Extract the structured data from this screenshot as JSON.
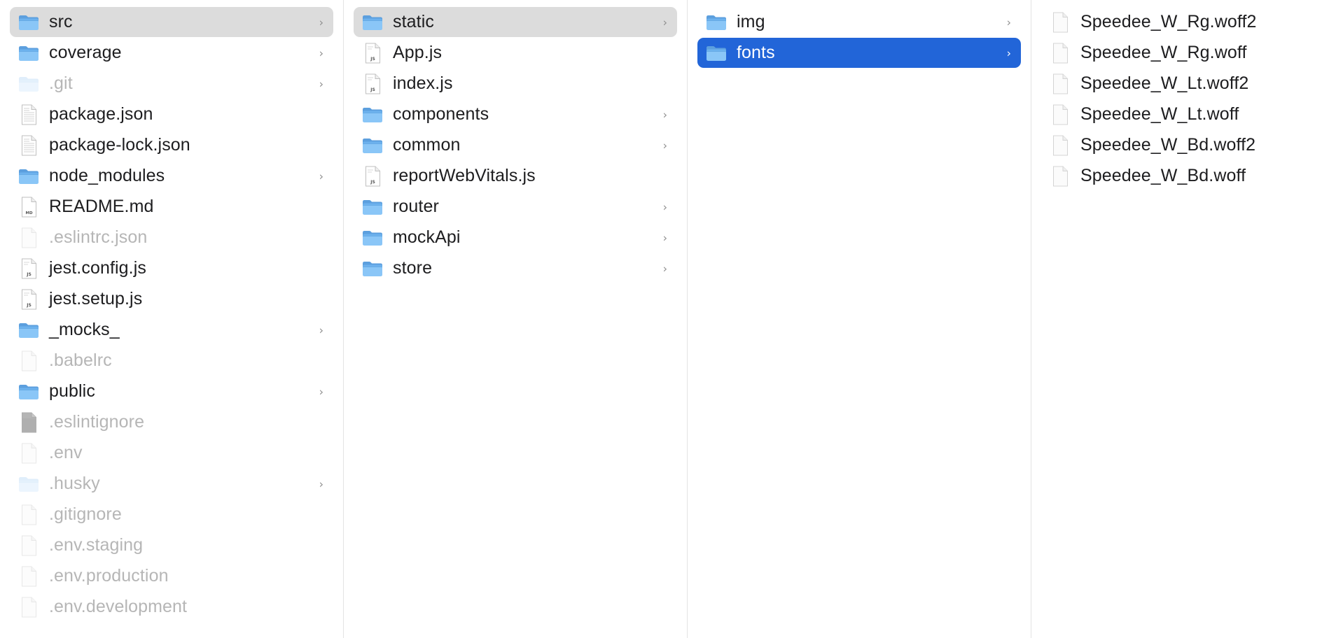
{
  "columns": [
    {
      "items": [
        {
          "label": "src",
          "type": "folder",
          "chevron": true,
          "state": "path",
          "hidden": false
        },
        {
          "label": "coverage",
          "type": "folder",
          "chevron": true,
          "state": "",
          "hidden": false
        },
        {
          "label": ".git",
          "type": "folder",
          "chevron": true,
          "state": "",
          "hidden": true
        },
        {
          "label": "package.json",
          "type": "doc",
          "chevron": false,
          "state": "",
          "hidden": false
        },
        {
          "label": "package-lock.json",
          "type": "doc",
          "chevron": false,
          "state": "",
          "hidden": false
        },
        {
          "label": "node_modules",
          "type": "folder",
          "chevron": true,
          "state": "",
          "hidden": false
        },
        {
          "label": "README.md",
          "type": "md",
          "chevron": false,
          "state": "",
          "hidden": false
        },
        {
          "label": ".eslintrc.json",
          "type": "blank",
          "chevron": false,
          "state": "",
          "hidden": true
        },
        {
          "label": "jest.config.js",
          "type": "js",
          "chevron": false,
          "state": "",
          "hidden": false
        },
        {
          "label": "jest.setup.js",
          "type": "js",
          "chevron": false,
          "state": "",
          "hidden": false
        },
        {
          "label": "_mocks_",
          "type": "folder",
          "chevron": true,
          "state": "",
          "hidden": false
        },
        {
          "label": ".babelrc",
          "type": "blank",
          "chevron": false,
          "state": "",
          "hidden": true
        },
        {
          "label": "public",
          "type": "folder",
          "chevron": true,
          "state": "",
          "hidden": false
        },
        {
          "label": ".eslintignore",
          "type": "dark",
          "chevron": false,
          "state": "",
          "hidden": true
        },
        {
          "label": ".env",
          "type": "blank",
          "chevron": false,
          "state": "",
          "hidden": true
        },
        {
          "label": ".husky",
          "type": "folder",
          "chevron": true,
          "state": "",
          "hidden": true
        },
        {
          "label": ".gitignore",
          "type": "blank",
          "chevron": false,
          "state": "",
          "hidden": true
        },
        {
          "label": ".env.staging",
          "type": "blank",
          "chevron": false,
          "state": "",
          "hidden": true
        },
        {
          "label": ".env.production",
          "type": "blank",
          "chevron": false,
          "state": "",
          "hidden": true
        },
        {
          "label": ".env.development",
          "type": "blank",
          "chevron": false,
          "state": "",
          "hidden": true
        }
      ]
    },
    {
      "items": [
        {
          "label": "static",
          "type": "folder",
          "chevron": true,
          "state": "path",
          "hidden": false
        },
        {
          "label": "App.js",
          "type": "js",
          "chevron": false,
          "state": "",
          "hidden": false
        },
        {
          "label": "index.js",
          "type": "js",
          "chevron": false,
          "state": "",
          "hidden": false
        },
        {
          "label": "components",
          "type": "folder",
          "chevron": true,
          "state": "",
          "hidden": false
        },
        {
          "label": "common",
          "type": "folder",
          "chevron": true,
          "state": "",
          "hidden": false
        },
        {
          "label": "reportWebVitals.js",
          "type": "js",
          "chevron": false,
          "state": "",
          "hidden": false
        },
        {
          "label": "router",
          "type": "folder",
          "chevron": true,
          "state": "",
          "hidden": false
        },
        {
          "label": "mockApi",
          "type": "folder",
          "chevron": true,
          "state": "",
          "hidden": false
        },
        {
          "label": "store",
          "type": "folder",
          "chevron": true,
          "state": "",
          "hidden": false
        }
      ]
    },
    {
      "items": [
        {
          "label": "img",
          "type": "folder",
          "chevron": true,
          "state": "",
          "hidden": false
        },
        {
          "label": "fonts",
          "type": "folder",
          "chevron": true,
          "state": "selected",
          "hidden": false
        }
      ]
    },
    {
      "items": [
        {
          "label": "Speedee_W_Rg.woff2",
          "type": "blank",
          "chevron": false,
          "state": "",
          "hidden": false
        },
        {
          "label": "Speedee_W_Rg.woff",
          "type": "blank",
          "chevron": false,
          "state": "",
          "hidden": false
        },
        {
          "label": "Speedee_W_Lt.woff2",
          "type": "blank",
          "chevron": false,
          "state": "",
          "hidden": false
        },
        {
          "label": "Speedee_W_Lt.woff",
          "type": "blank",
          "chevron": false,
          "state": "",
          "hidden": false
        },
        {
          "label": "Speedee_W_Bd.woff2",
          "type": "blank",
          "chevron": false,
          "state": "",
          "hidden": false
        },
        {
          "label": "Speedee_W_Bd.woff",
          "type": "blank",
          "chevron": false,
          "state": "",
          "hidden": false
        }
      ]
    }
  ],
  "icons": {
    "folder": "folder-icon",
    "doc": "document-icon",
    "js": "js-file-icon",
    "md": "markdown-file-icon",
    "blank": "blank-file-icon",
    "dark": "dark-file-icon"
  },
  "glyphs": {
    "chevron": "›"
  },
  "colors": {
    "selection": "#2265d8",
    "path_highlight": "#dcdcdc",
    "hidden_text": "#b6b6b6",
    "folder_blue": "#5fa8e8"
  }
}
